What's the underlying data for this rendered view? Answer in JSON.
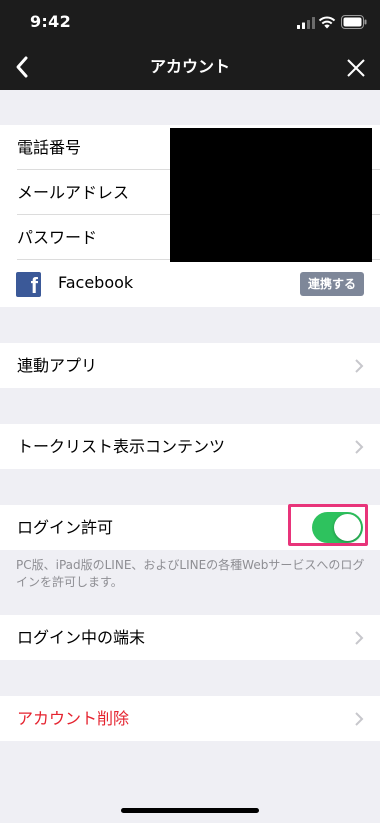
{
  "status_bar": {
    "time": "9:42"
  },
  "nav": {
    "title": "アカウント"
  },
  "account_info": {
    "phone_label": "電話番号",
    "email_label": "メールアドレス",
    "password_label": "パスワード"
  },
  "facebook": {
    "label": "Facebook",
    "link_button": "連携する"
  },
  "menu": {
    "linked_apps": "連動アプリ",
    "talk_list_contents": "トークリスト表示コンテンツ",
    "login_permission": "ログイン許可",
    "login_permission_enabled": true,
    "login_permission_help": "PC版、iPad版のLINE、およびLINEの各種Webサービスへのログインを許可します。",
    "logged_in_devices": "ログイン中の端末",
    "delete_account": "アカウント削除"
  },
  "colors": {
    "nav_background": "#1c1c1c",
    "toggle_on": "#2ec25e",
    "facebook_blue": "#3b5998",
    "link_button": "#7e8799",
    "danger": "#e5232f",
    "highlight": "#e8347a"
  }
}
